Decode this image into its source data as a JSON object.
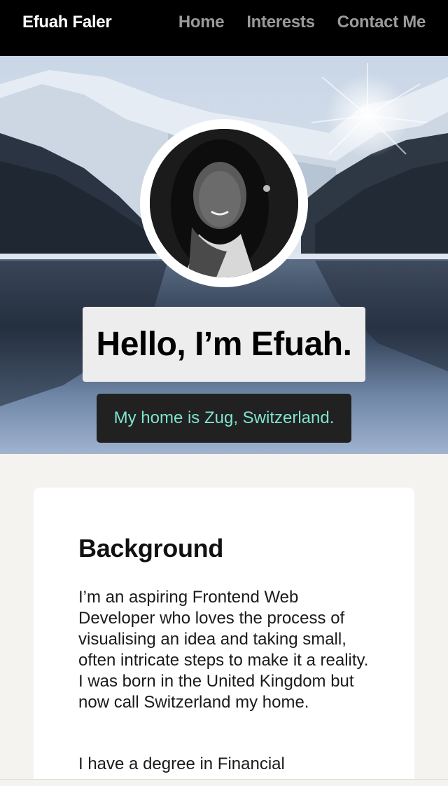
{
  "nav": {
    "brand": "Efuah Faler",
    "links": [
      "Home",
      "Interests",
      "Contact Me"
    ]
  },
  "hero": {
    "headline": "Hello, I’m Efuah.",
    "subline": "My home is Zug, Switzerland."
  },
  "background": {
    "heading": "Background",
    "paragraphs": [
      "I’m an aspiring Frontend Web Developer who loves the process of visualising an idea and taking small, often intricate steps to make it a reality. I was born in the United Kingdom but now call Switzerland my home.",
      "I have a degree in Financial"
    ]
  },
  "colors": {
    "nav_bg": "#000000",
    "nav_link": "#9a9a9a",
    "subline_text": "#7fe3cf",
    "subline_bg": "#212121",
    "page_bg": "#f4f3ef"
  }
}
